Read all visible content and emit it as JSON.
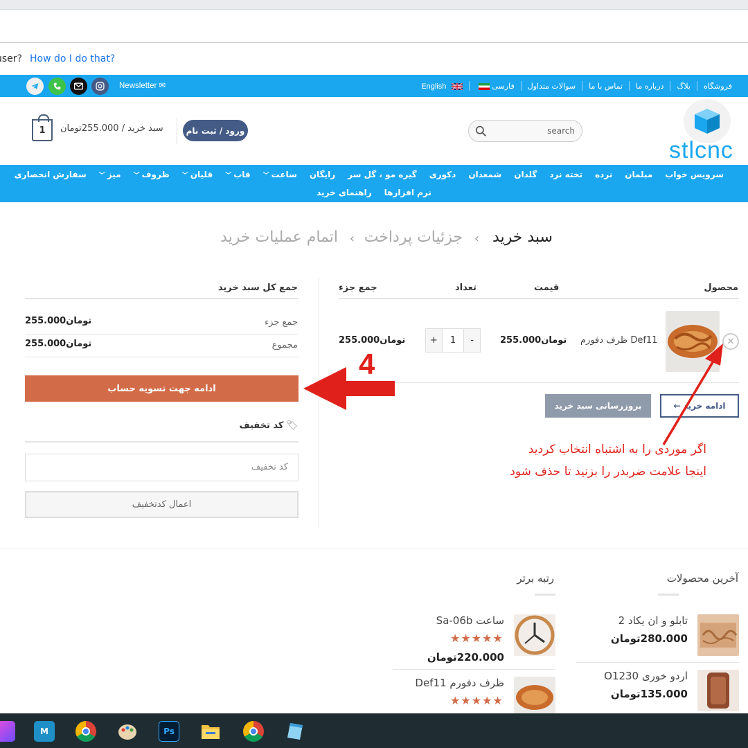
{
  "infobar": {
    "question": "user?",
    "link": "How do I do that?"
  },
  "topbar": {
    "newsletter": "Newsletter",
    "links": [
      "فروشگاه",
      "بلاگ",
      "درباره ما",
      "تماس با ما",
      "سوالات متداول",
      "فارسی",
      "English"
    ]
  },
  "header": {
    "cart_count": "1",
    "cart_summary": "سبد خرید / 255.000تومان",
    "login": "ورود / ثبت نام",
    "search_placeholder": "search",
    "logo": "stlcnc"
  },
  "nav": {
    "row1": [
      {
        "label": "سرویس خواب",
        "dropdown": false
      },
      {
        "label": "مبلمان",
        "dropdown": false
      },
      {
        "label": "نرده",
        "dropdown": false
      },
      {
        "label": "تخته نرد",
        "dropdown": false
      },
      {
        "label": "گلدان",
        "dropdown": false
      },
      {
        "label": "شمعدان",
        "dropdown": false
      },
      {
        "label": "دکوری",
        "dropdown": false
      },
      {
        "label": "گیره مو ، گل سر",
        "dropdown": false
      },
      {
        "label": "رایگان",
        "dropdown": false
      },
      {
        "label": "ساعت",
        "dropdown": true
      },
      {
        "label": "قاب",
        "dropdown": true
      },
      {
        "label": "قلیان",
        "dropdown": true
      },
      {
        "label": "ظروف",
        "dropdown": true
      },
      {
        "label": "میز",
        "dropdown": true
      },
      {
        "label": "سفارش انحصاری",
        "dropdown": false
      }
    ],
    "row2": [
      "نرم افزارها",
      "راهنمای خرید"
    ]
  },
  "steps": {
    "cart": "سبد خرید",
    "checkout": "جزئیات پرداخت",
    "complete": "اتمام عملیات خرید"
  },
  "cart": {
    "headers": {
      "product": "محصول",
      "price": "قیمت",
      "quantity": "تعداد",
      "subtotal": "جمع جزء"
    },
    "item": {
      "name": "ظرف دفورم Def11",
      "price": "255.000تومان",
      "qty": "1",
      "subtotal": "255.000تومان"
    },
    "continue_shopping": "← ادامه خرید",
    "update_cart": "بروزرسانی سبد خرید"
  },
  "totals": {
    "title": "جمع کل سبد خرید",
    "subtotal_label": "جمع جزء",
    "subtotal_value": "255.000تومان",
    "total_label": "مجموع",
    "total_value": "255.000تومان",
    "checkout": "ادامه جهت تسویه حساب",
    "coupon_title": "کد تخفیف",
    "coupon_placeholder": "کد تخفیف",
    "apply_coupon": "اعمال کدتخفیف"
  },
  "annotations": {
    "step_number": "4",
    "line1": "اگر موردی را به اشتباه انتخاب کردید",
    "line2": "اینجا علامت ضربدر را بزنید تا حذف شود"
  },
  "widgets": {
    "latest": {
      "title": "آخرین محصولات",
      "items": [
        {
          "name": "تابلو و ان یکاد 2",
          "price": "280.000تومان"
        },
        {
          "name": "اردو خوری O1230",
          "price": "135.000تومان"
        }
      ]
    },
    "top_rated": {
      "title": "رتبه برتر",
      "items": [
        {
          "name": "ساعت Sa-06b",
          "price": "220.000تومان",
          "stars": "★★★★★"
        },
        {
          "name": "ظرف دفورم Def11",
          "price": "",
          "stars": "★★★★★"
        }
      ]
    }
  },
  "colors": {
    "brand_blue": "#1aa7f0",
    "accent": "#d26c48",
    "navy": "#445b86",
    "annotation_red": "#e0211b"
  },
  "taskbar": {
    "icons": [
      "copilot-icon",
      "m-aya-icon",
      "chrome-icon",
      "paint-icon",
      "photoshop-icon",
      "file-explorer-icon",
      "chrome-profile-icon",
      "notepad-icon"
    ],
    "ps_label": "Ps",
    "m_label": "M"
  }
}
